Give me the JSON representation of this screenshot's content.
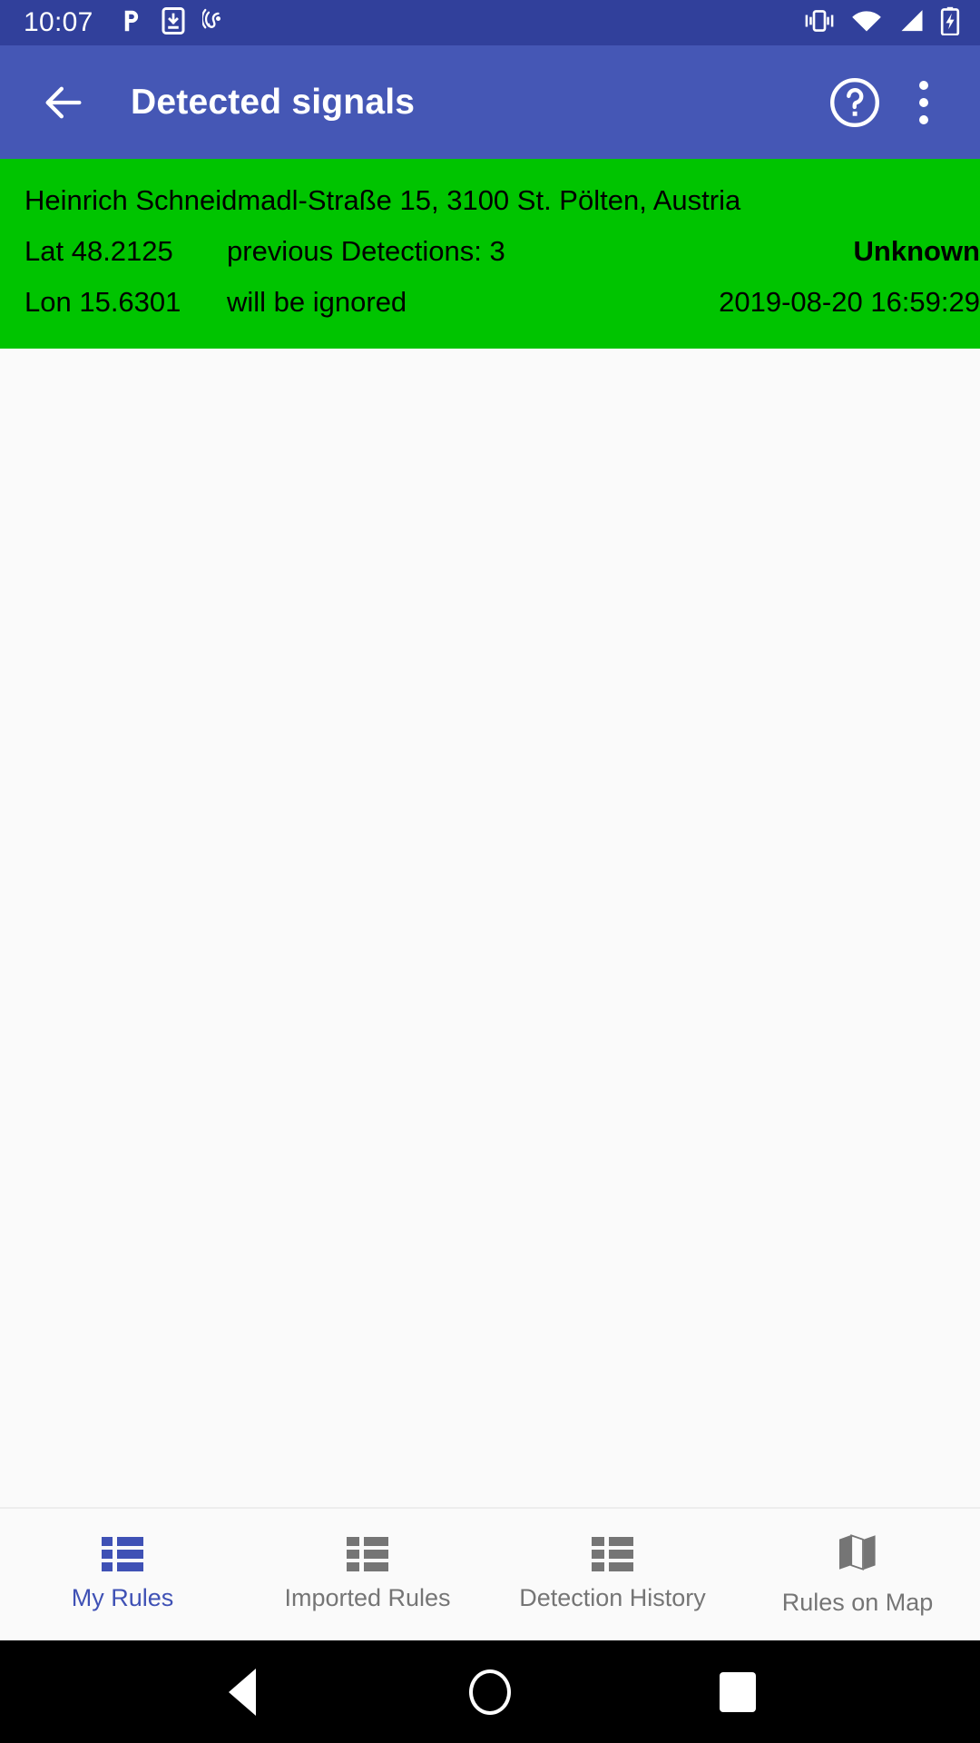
{
  "status_bar": {
    "clock": "10:07",
    "left_icons": [
      "pocketcasts-p-icon",
      "download-to-phone-icon",
      "hearing-aid-icon"
    ],
    "right_icons": [
      "vibrate-icon",
      "wifi-icon",
      "cellular-signal-icon",
      "battery-charging-icon"
    ],
    "background": "#31409B"
  },
  "app_bar": {
    "title": "Detected signals",
    "back_icon": "arrow-back-icon",
    "help_icon": "help-circle-icon",
    "overflow_icon": "overflow-menu-icon",
    "background": "#4557B5"
  },
  "signals": [
    {
      "address": "Heinrich Schneidmadl-Straße 15, 3100 St. Pölten, Austria",
      "lat": "Lat 48.2125",
      "lon": "Lon 15.6301",
      "previous_detections": "previous Detections: 3",
      "ignored_note": "will be ignored",
      "status": "Unknown",
      "timestamp": "2019-08-20 16:59:29",
      "background": "#00C400"
    }
  ],
  "bottom_nav": {
    "active_color": "#3F51B5",
    "inactive_color": "#757575",
    "items": [
      {
        "label": "My Rules",
        "icon": "list-icon",
        "active": true
      },
      {
        "label": "Imported Rules",
        "icon": "list-icon",
        "active": false
      },
      {
        "label": "Detection History",
        "icon": "list-icon",
        "active": false
      },
      {
        "label": "Rules on Map",
        "icon": "map-icon",
        "active": false
      }
    ]
  },
  "system_nav": {
    "back": "android-back-icon",
    "home": "android-home-icon",
    "recents": "android-recents-icon"
  }
}
